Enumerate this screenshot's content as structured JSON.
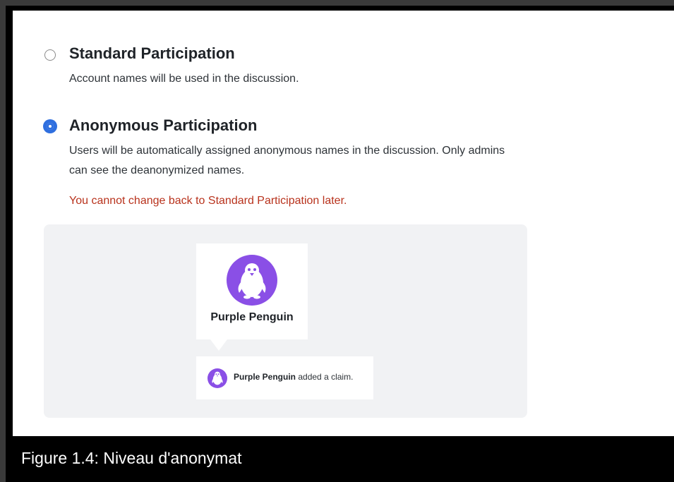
{
  "options": [
    {
      "title": "Standard Participation",
      "description": "Account names will be used in the discussion.",
      "selected": false
    },
    {
      "title": "Anonymous Participation",
      "description": "Users will be automatically assigned anonymous names in the discussion. Only admins can see the deanonymized names.",
      "selected": true
    }
  ],
  "warning": "You cannot change back to Standard Participation later.",
  "preview": {
    "avatar_icon": "penguin-icon",
    "avatar_color": "#8a4fe6",
    "card_name": "Purple Penguin",
    "activity_name": "Purple Penguin",
    "activity_action": "added a claim."
  },
  "caption": "Figure 1.4: Niveau d'anonymat",
  "colors": {
    "radio_selected": "#2f6fdf",
    "warning": "#b8321c",
    "preview_background": "#f1f2f4"
  }
}
